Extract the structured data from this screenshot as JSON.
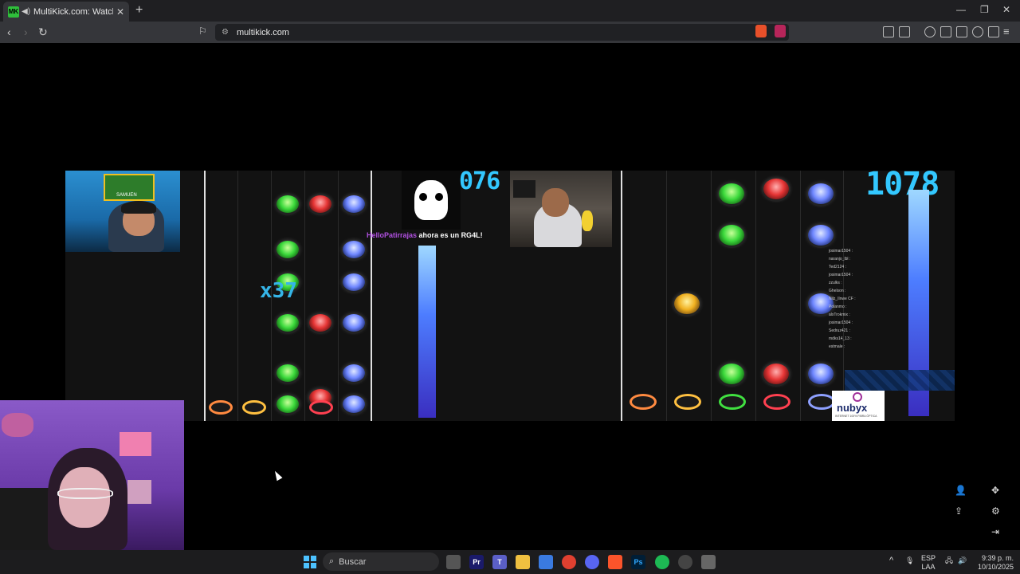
{
  "browser": {
    "tab_title": "MultiKick.com: Watch Multip",
    "favicon": "MK",
    "url": "multikick.com",
    "new_tab": "+",
    "close": "✕"
  },
  "stream": {
    "score_left": "076",
    "score_right": "1078",
    "multiplier": "x37",
    "chat_highlight_user": "HelloPatirrajas",
    "chat_highlight_msg": "ahora es un RG4L!",
    "cam1_label": "SAMUEN",
    "sponsor": "nubyx",
    "sponsor_sub": "INTERNET 100% FIBRA ÓPTICA",
    "chat_lines": [
      "josimar1504 :",
      "naranjo_lbl :",
      "Ted2124 :",
      "josimar1504 :",
      "zzulks :",
      "Ghelson :",
      "Nilz_Ilnwe CF :",
      "Polanmo :",
      "alxTrokmix :",
      "josimar1504 :",
      "Sedruz421 :",
      "mdks14_13 :",
      "estmale :"
    ]
  },
  "taskbar": {
    "search_placeholder": "Buscar",
    "lang_top": "ESP",
    "lang_bottom": "LAA",
    "time": "9:39 p. m.",
    "date": "10/10/2025"
  }
}
